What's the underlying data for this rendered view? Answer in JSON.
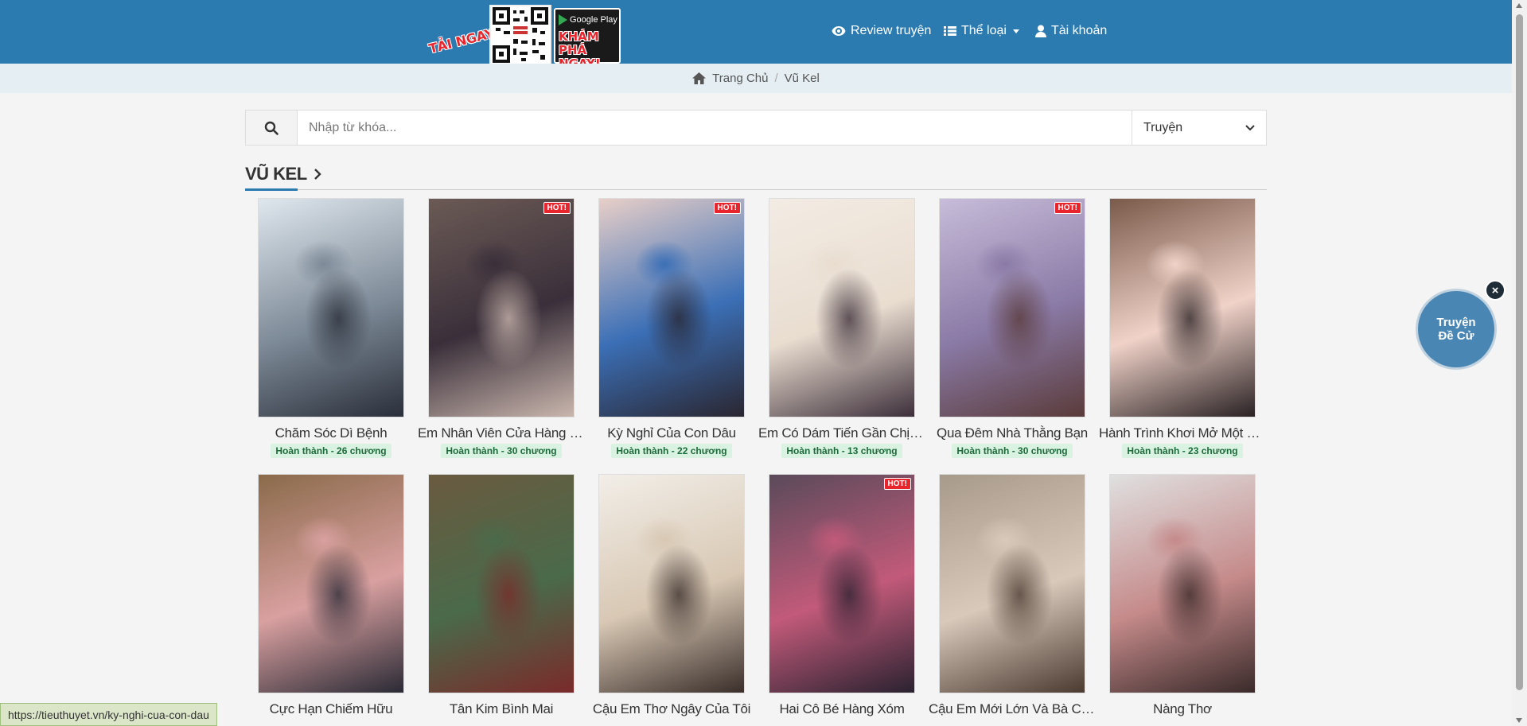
{
  "header": {
    "promo_tai_ngay": "TẢI NGAY",
    "promo_google_play": "Google Play",
    "promo_kham_pha": "KHÁM PHÁ",
    "promo_ngay": "NGAY!",
    "nav": [
      {
        "label": "Review truyện",
        "icon": "eye-icon"
      },
      {
        "label": "Thể loại",
        "icon": "list-icon"
      },
      {
        "label": "Tài khoản",
        "icon": "user-icon"
      }
    ]
  },
  "breadcrumb": {
    "home": "Trang Chủ",
    "separator": "/",
    "current": "Vũ Kel"
  },
  "search": {
    "placeholder": "Nhập từ khóa...",
    "select_value": "Truyện"
  },
  "section": {
    "title": "VŨ KEL"
  },
  "stories": [
    {
      "title": "Chăm Sóc Dì Bệnh",
      "status": "Hoàn thành - 26 chương",
      "hot": false,
      "colors": [
        "#dfe7ee",
        "#7d8a97",
        "#2a2f3a"
      ]
    },
    {
      "title": "Em Nhân Viên Cửa Hàng V...",
      "status": "Hoàn thành - 30 chương",
      "hot": true,
      "colors": [
        "#6b5a55",
        "#3a2f3a",
        "#c9b6ad"
      ]
    },
    {
      "title": "Kỳ Nghỉ Của Con Dâu",
      "status": "Hoàn thành - 22 chương",
      "hot": true,
      "colors": [
        "#e8cfc8",
        "#3b6fb6",
        "#2a2630"
      ]
    },
    {
      "title": "Em Có Dám Tiến Gần Chị H...",
      "status": "Hoàn thành - 13 chương",
      "hot": false,
      "colors": [
        "#f3ece4",
        "#e9ddd0",
        "#3d2f3a"
      ]
    },
    {
      "title": "Qua Đêm Nhà Thằng Bạn",
      "status": "Hoàn thành - 30 chương",
      "hot": true,
      "colors": [
        "#c7bcd9",
        "#8a7aa6",
        "#5a3b3a"
      ]
    },
    {
      "title": "Hành Trình Khơi Mở Một C...",
      "status": "Hoàn thành - 23 chương",
      "hot": false,
      "colors": [
        "#7a5a4a",
        "#f0d2c8",
        "#2a2224"
      ]
    },
    {
      "title": "Cực Hạn Chiếm Hữu",
      "status": "",
      "hot": false,
      "colors": [
        "#8a6a4a",
        "#d9a0a0",
        "#2a2a35"
      ]
    },
    {
      "title": "Tân Kim Bình Mai",
      "status": "",
      "hot": false,
      "colors": [
        "#6a5a40",
        "#4a6a4a",
        "#7a2a2a"
      ]
    },
    {
      "title": "Cậu Em Thơ Ngây Của Tôi",
      "status": "",
      "hot": false,
      "colors": [
        "#f2eee8",
        "#d8c8b4",
        "#3a2e2a"
      ]
    },
    {
      "title": "Hai Cô Bé Hàng Xóm",
      "status": "",
      "hot": true,
      "colors": [
        "#5a4a5a",
        "#c25a7a",
        "#2a2230"
      ]
    },
    {
      "title": "Cậu Em Mới Lớn Và Bà Chị ...",
      "status": "",
      "hot": false,
      "colors": [
        "#a89a8a",
        "#d9c9bb",
        "#4a3a30"
      ]
    },
    {
      "title": "Nàng Thơ",
      "status": "",
      "hot": false,
      "colors": [
        "#e0e0e0",
        "#c58a8a",
        "#3a2a2a"
      ]
    }
  ],
  "hot_label": "HOT!",
  "float_button": {
    "label_line1": "Truyện",
    "label_line2": "Đề Cử",
    "close": "×"
  },
  "status_url": "https://tieuthuyet.vn/ky-nghi-cua-con-dau",
  "colors": {
    "header_bg": "#2b7bb0",
    "breadcrumb_bg": "#e5eef3",
    "status_green_bg": "#d9f2e1",
    "status_green_text": "#1d6b3a"
  }
}
